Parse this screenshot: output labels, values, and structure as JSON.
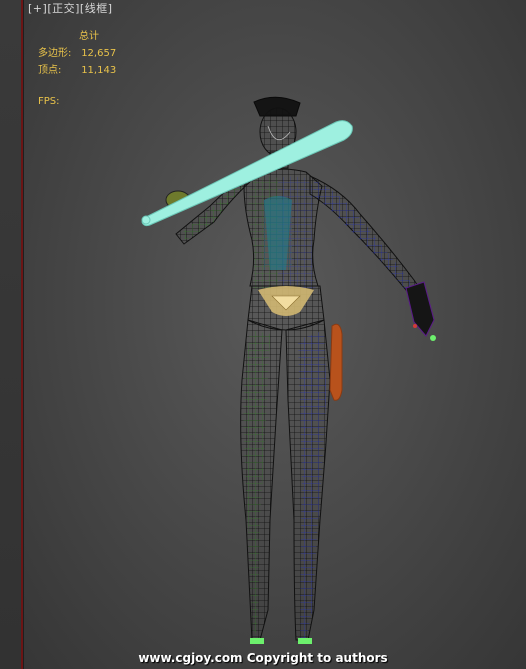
{
  "viewport": {
    "label_plus": "[+]",
    "label_view": "[正交]",
    "label_shading": "[线框]"
  },
  "stats": {
    "header": "总计",
    "polys_label": "多边形:",
    "polys_value": "12,657",
    "verts_label": "顶点:",
    "verts_value": "11,143",
    "fps_label": "FPS:"
  },
  "colors": {
    "stats_text": "#e8c24a",
    "border_accent": "#6b1515",
    "wire_green": "#3d8f2a",
    "wire_blue": "#2a36c8",
    "wire_cyan": "#2aa4b8",
    "bat": "#9ef0e0",
    "holster": "#b8521c"
  },
  "watermark": "www.cgjoy.com Copyright to authors"
}
